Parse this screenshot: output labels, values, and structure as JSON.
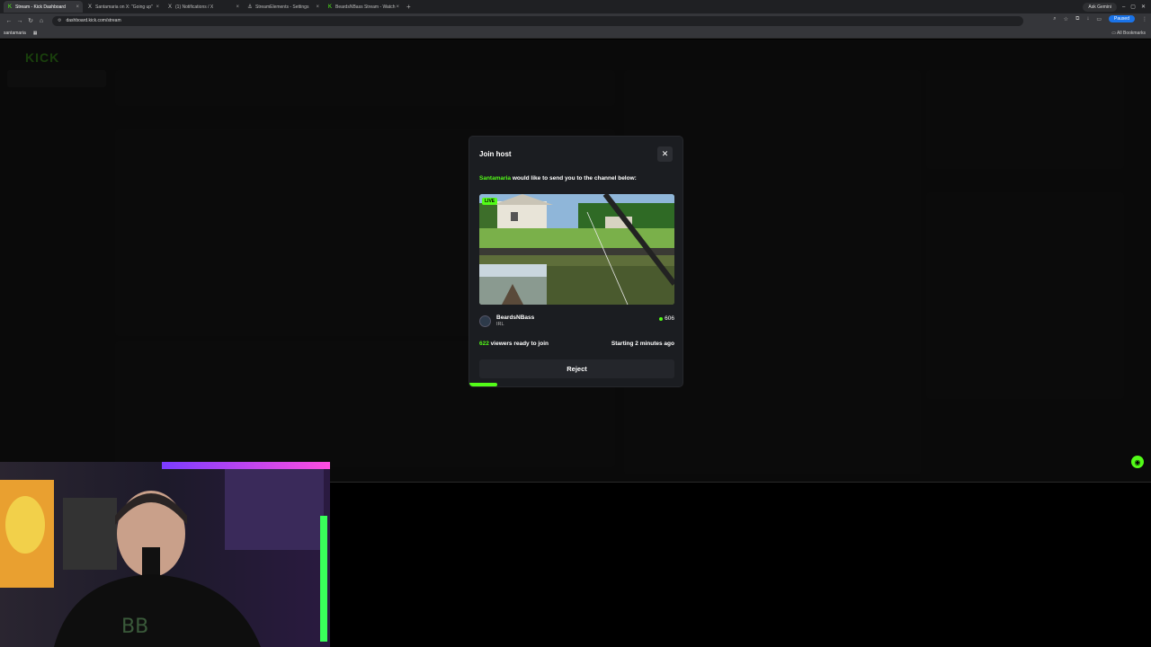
{
  "browser": {
    "tabs": [
      {
        "label": "Stream - Kick Dashboard",
        "icon": "kick-favicon",
        "active": true
      },
      {
        "label": "Santamaria on X: \"Going up\"",
        "icon": "x-favicon",
        "active": false
      },
      {
        "label": "(1) Notifications / X",
        "icon": "x-favicon",
        "active": false
      },
      {
        "label": "StreamElements - Settings",
        "icon": "streamelements-favicon",
        "active": false
      },
      {
        "label": "BeardsNBass Stream - Watch",
        "icon": "kick-favicon",
        "active": false
      }
    ],
    "ask_gemini": "Ask Gemini",
    "url": "dashboard.kick.com/stream",
    "paused_label": "Paused",
    "bookmarks": [
      "santamaria"
    ],
    "all_bookmarks": "All Bookmarks"
  },
  "modal": {
    "title": "Join host",
    "host_name": "Santamaria",
    "invite_text": " would like to send you to the channel below:",
    "live_badge": "LIVE",
    "channel": {
      "name": "BeardsNBass",
      "category": "IRL",
      "viewers": "606"
    },
    "ready_count": "622",
    "ready_text": " viewers ready to join",
    "starting_text": "Starting 2 minutes ago",
    "reject_label": "Reject",
    "progress": 0.13
  },
  "colors": {
    "accent": "#53fc18",
    "modal_bg": "#1b1d21",
    "page_bg": "#000000"
  }
}
